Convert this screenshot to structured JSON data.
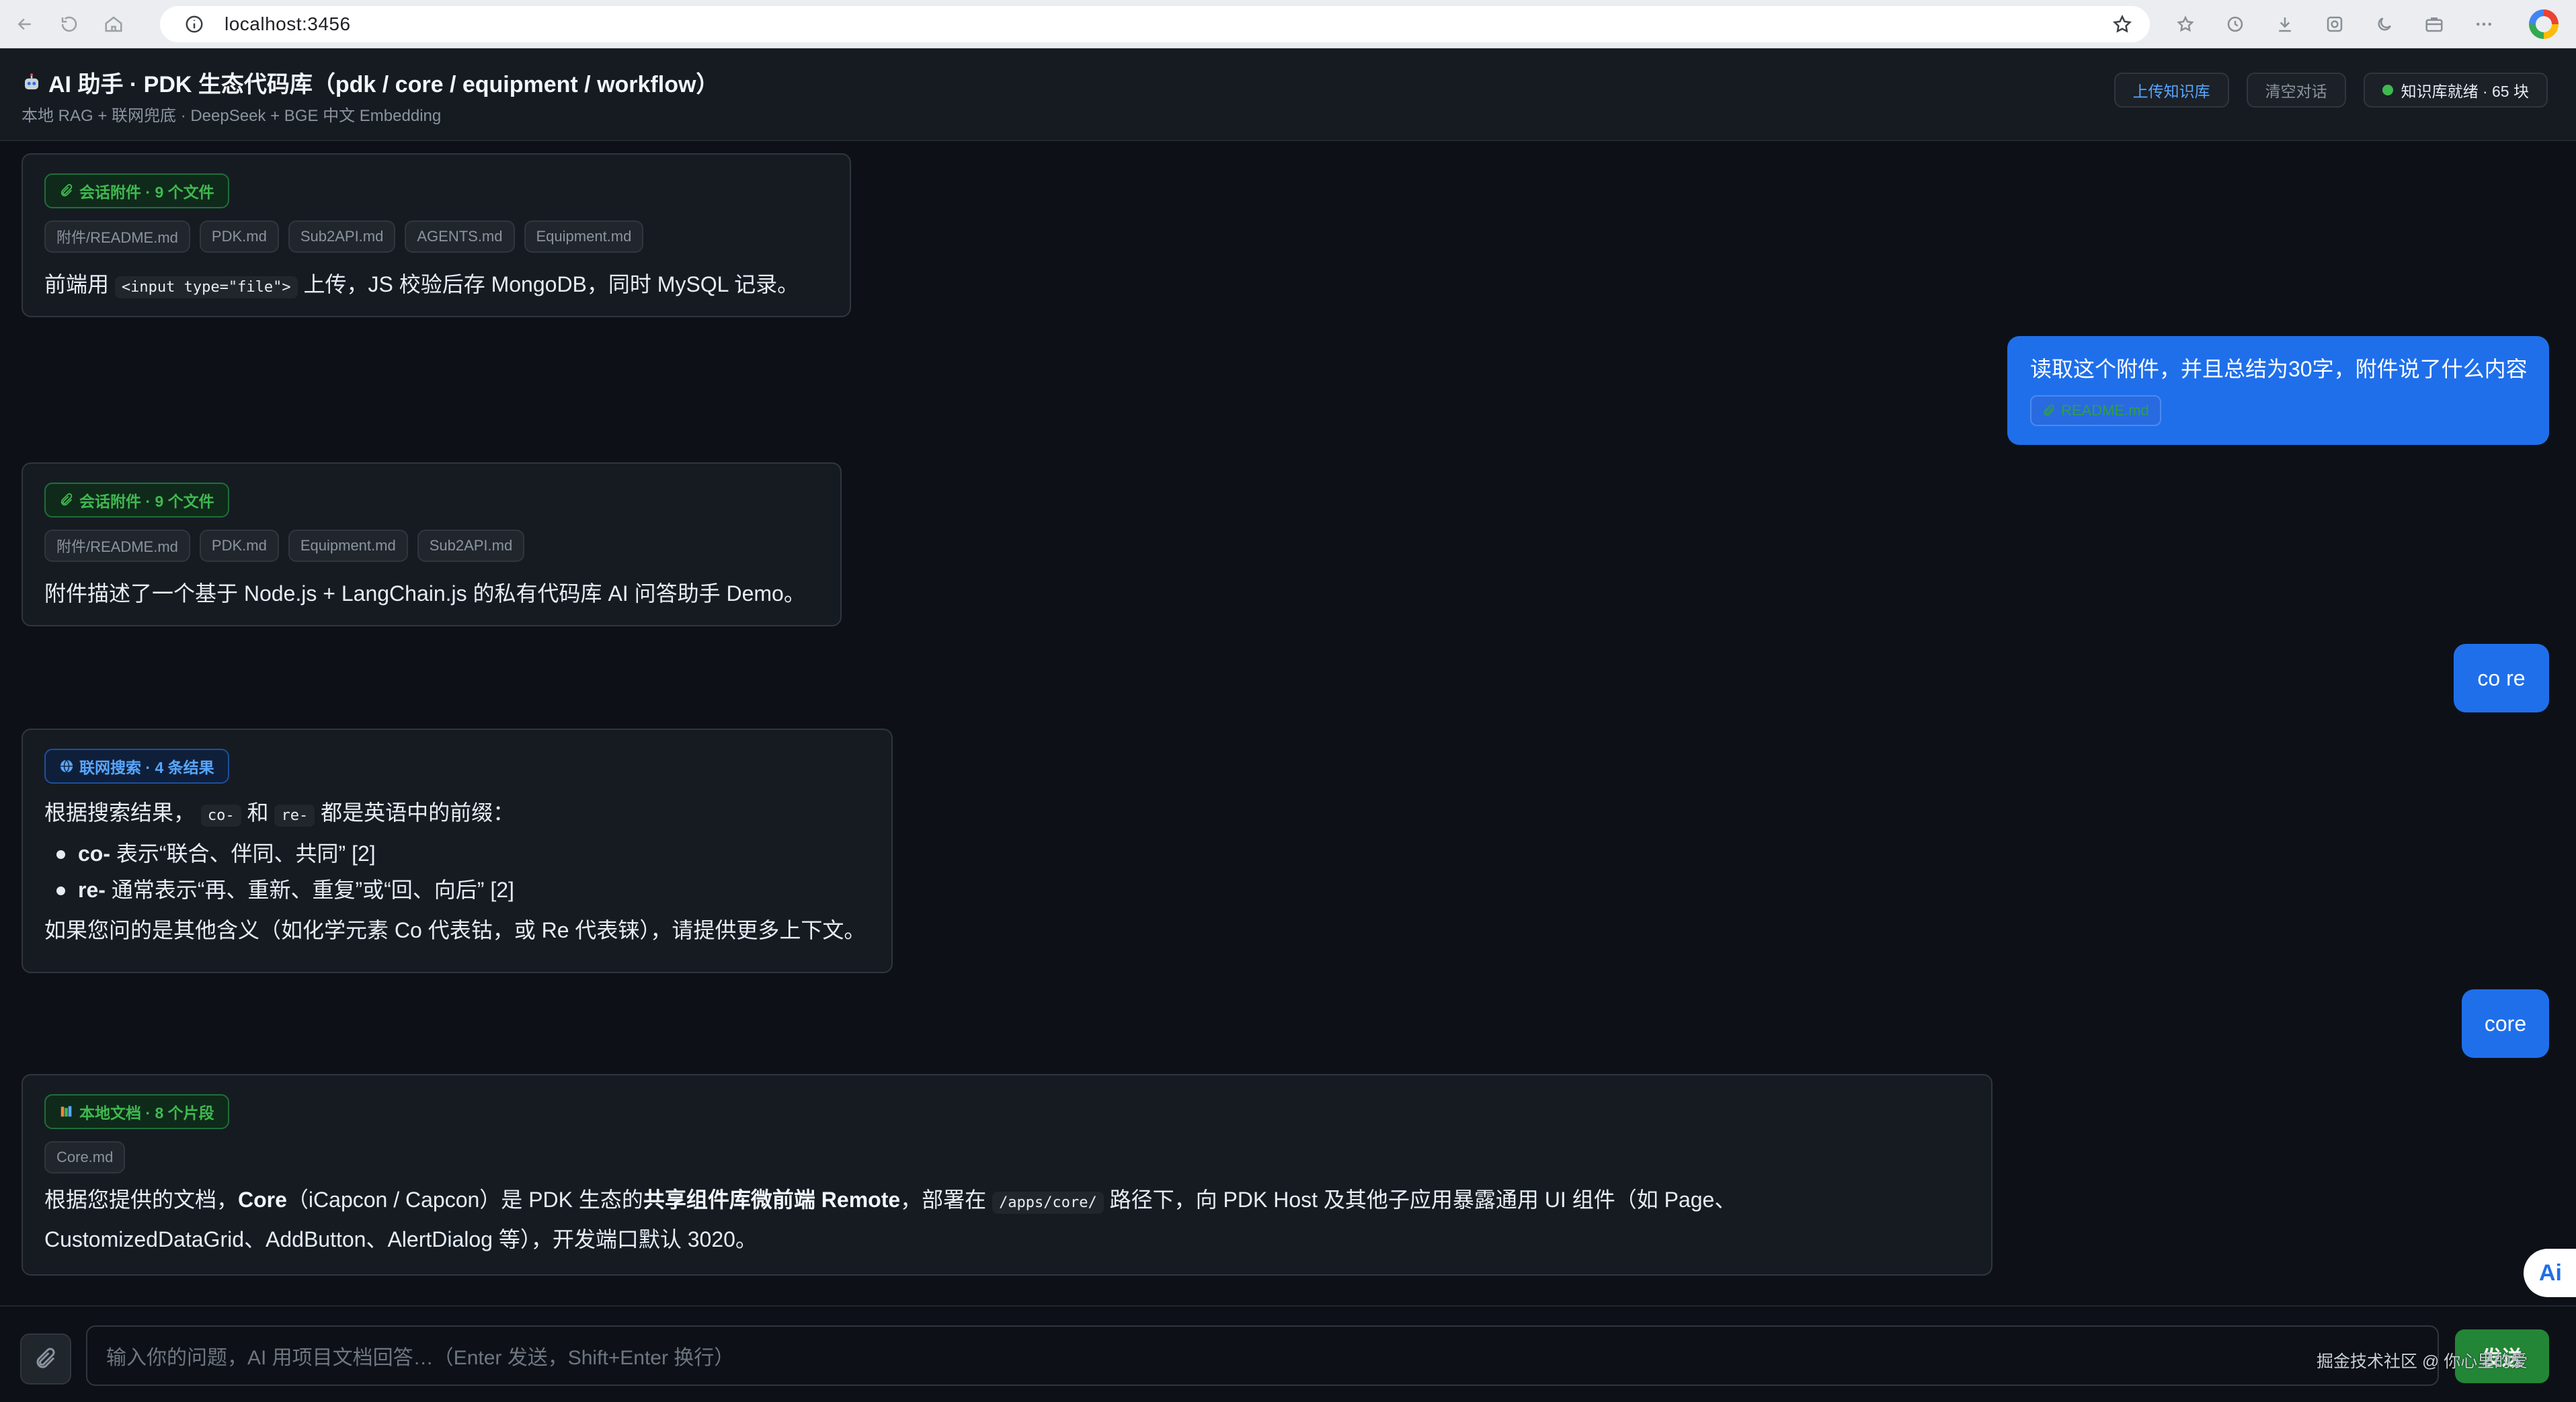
{
  "browser": {
    "url": "localhost:3456"
  },
  "header": {
    "title": "AI 助手 · PDK 生态代码库（pdk / core / equipment / workflow）",
    "subtitle": "本地 RAG + 联网兜底 · DeepSeek + BGE 中文 Embedding",
    "upload_label": "上传知识库",
    "clear_label": "清空对话",
    "status_label": "知识库就绪 · 65 块",
    "status_color": "#3fb950"
  },
  "messages": {
    "bot1": {
      "tag": "会话附件 · 9 个文件",
      "chips": [
        "附件/README.md",
        "PDK.md",
        "Sub2API.md",
        "AGENTS.md",
        "Equipment.md"
      ],
      "text_pre": "前端用",
      "code": "<input type=\"file\">",
      "text_post": "上传，JS 校验后存 MongoDB，同时 MySQL 记录。"
    },
    "user1": {
      "text": "读取这个附件，并且总结为30字，附件说了什么内容",
      "attachment": "README.md"
    },
    "bot2": {
      "tag": "会话附件 · 9 个文件",
      "chips": [
        "附件/README.md",
        "PDK.md",
        "Equipment.md",
        "Sub2API.md"
      ],
      "text": "附件描述了一个基于 Node.js + LangChain.js 的私有代码库 AI 问答助手 Demo。"
    },
    "user2": {
      "text": "co re"
    },
    "bot3": {
      "tag": "联网搜索 · 4 条结果",
      "intro_pre": "根据搜索结果，",
      "code1": "co-",
      "intro_mid": "和",
      "code2": "re-",
      "intro_post": "都是英语中的前缀：",
      "bullets": [
        {
          "term": "co-",
          "desc": "表示“联合、伴同、共同” [2]"
        },
        {
          "term": "re-",
          "desc": "通常表示“再、重新、重复”或“回、向后” [2]"
        }
      ],
      "outro": "如果您问的是其他含义（如化学元素 Co 代表钴，或 Re 代表铼），请提供更多上下文。"
    },
    "user3": {
      "text": "core"
    },
    "bot4": {
      "tag": "本地文档 · 8 个片段",
      "chips": [
        "Core.md"
      ],
      "l1_a": "根据您提供的文档，",
      "l1_b": "Core",
      "l1_c": "（iCapcon / Capcon）是 PDK 生态的",
      "l1_d": "共享组件库微前端 Remote",
      "l1_e": "，部署在",
      "l1_code": "/apps/core/",
      "l1_f": "路径下，向 PDK Host 及其他子应用暴露通用 UI 组件（如 Page、",
      "l2": "CustomizedDataGrid、AddButton、AlertDialog 等），开发端口默认 3020。"
    }
  },
  "composer": {
    "placeholder": "输入你的问题，AI 用项目文档回答…（Enter 发送，Shift+Enter 换行）",
    "send_label": "发送"
  },
  "float_badge": "Ai",
  "watermark": "掘金技术社区 @ 你心里的爱"
}
